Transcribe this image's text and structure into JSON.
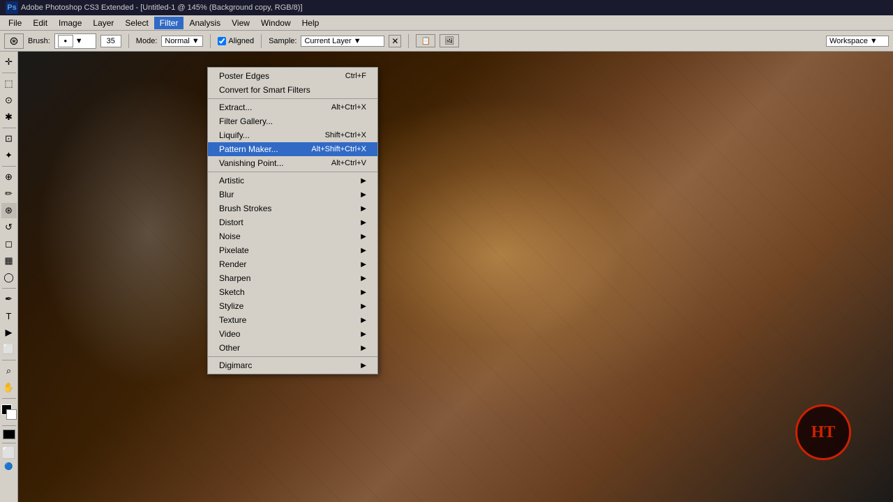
{
  "title_bar": {
    "ps_logo": "Ps",
    "title": "Adobe Photoshop CS3 Extended - [Untitled-1 @ 145% (Background copy, RGB/8)]"
  },
  "menu_bar": {
    "items": [
      {
        "id": "file",
        "label": "File"
      },
      {
        "id": "edit",
        "label": "Edit"
      },
      {
        "id": "image",
        "label": "Image"
      },
      {
        "id": "layer",
        "label": "Layer"
      },
      {
        "id": "select",
        "label": "Select"
      },
      {
        "id": "filter",
        "label": "Filter"
      },
      {
        "id": "analysis",
        "label": "Analysis"
      },
      {
        "id": "view",
        "label": "View"
      },
      {
        "id": "window",
        "label": "Window"
      },
      {
        "id": "help",
        "label": "Help"
      }
    ]
  },
  "options_bar": {
    "brush_label": "Brush:",
    "brush_size": "35",
    "mode_label": "Mode:",
    "mode_value": "Normal",
    "aligned_label": "Aligned",
    "sample_label": "Sample:",
    "sample_value": "Current Layer",
    "workspace_label": "Workspace"
  },
  "filter_menu": {
    "top_items": [
      {
        "label": "Poster Edges",
        "shortcut": "Ctrl+F",
        "has_arrow": false
      },
      {
        "label": "Convert for Smart Filters",
        "shortcut": "",
        "has_arrow": false
      }
    ],
    "mid_items": [
      {
        "label": "Extract...",
        "shortcut": "Alt+Ctrl+X",
        "has_arrow": false
      },
      {
        "label": "Filter Gallery...",
        "shortcut": "",
        "has_arrow": false
      },
      {
        "label": "Liquify...",
        "shortcut": "Shift+Ctrl+X",
        "has_arrow": false
      },
      {
        "label": "Pattern Maker...",
        "shortcut": "Alt+Shift+Ctrl+X",
        "has_arrow": false,
        "highlighted": true
      },
      {
        "label": "Vanishing Point...",
        "shortcut": "Alt+Ctrl+V",
        "has_arrow": false
      }
    ],
    "filter_groups": [
      {
        "label": "Artistic",
        "has_arrow": true
      },
      {
        "label": "Blur",
        "has_arrow": true
      },
      {
        "label": "Brush Strokes",
        "has_arrow": true
      },
      {
        "label": "Distort",
        "has_arrow": true
      },
      {
        "label": "Noise",
        "has_arrow": true
      },
      {
        "label": "Pixelate",
        "has_arrow": true
      },
      {
        "label": "Render",
        "has_arrow": true
      },
      {
        "label": "Sharpen",
        "has_arrow": true
      },
      {
        "label": "Sketch",
        "has_arrow": true
      },
      {
        "label": "Stylize",
        "has_arrow": true
      },
      {
        "label": "Texture",
        "has_arrow": true
      },
      {
        "label": "Video",
        "has_arrow": true
      },
      {
        "label": "Other",
        "has_arrow": true
      },
      {
        "label": "Digimarc",
        "has_arrow": true
      }
    ]
  },
  "tools": [
    {
      "name": "move",
      "icon": "✛"
    },
    {
      "name": "marquee",
      "icon": "⬚"
    },
    {
      "name": "lasso",
      "icon": "⌖"
    },
    {
      "name": "magic-wand",
      "icon": "✱"
    },
    {
      "name": "crop",
      "icon": "⊡"
    },
    {
      "name": "eyedropper",
      "icon": "⌀"
    },
    {
      "name": "healing-brush",
      "icon": "⊕"
    },
    {
      "name": "brush",
      "icon": "✏"
    },
    {
      "name": "clone-stamp",
      "icon": "⊛"
    },
    {
      "name": "history-brush",
      "icon": "↺"
    },
    {
      "name": "eraser",
      "icon": "◻"
    },
    {
      "name": "gradient",
      "icon": "▦"
    },
    {
      "name": "dodge",
      "icon": "◯"
    },
    {
      "name": "pen",
      "icon": "✒"
    },
    {
      "name": "type",
      "icon": "T"
    },
    {
      "name": "path-selection",
      "icon": "▶"
    },
    {
      "name": "shape",
      "icon": "⬜"
    },
    {
      "name": "zoom",
      "icon": "⌕"
    }
  ],
  "ht_logo": "HT",
  "colors": {
    "accent_blue": "#316ac5",
    "menu_bg": "#d4d0c8",
    "highlight_bg": "#316ac5",
    "highlight_text": "#ffffff",
    "border": "#888888"
  }
}
